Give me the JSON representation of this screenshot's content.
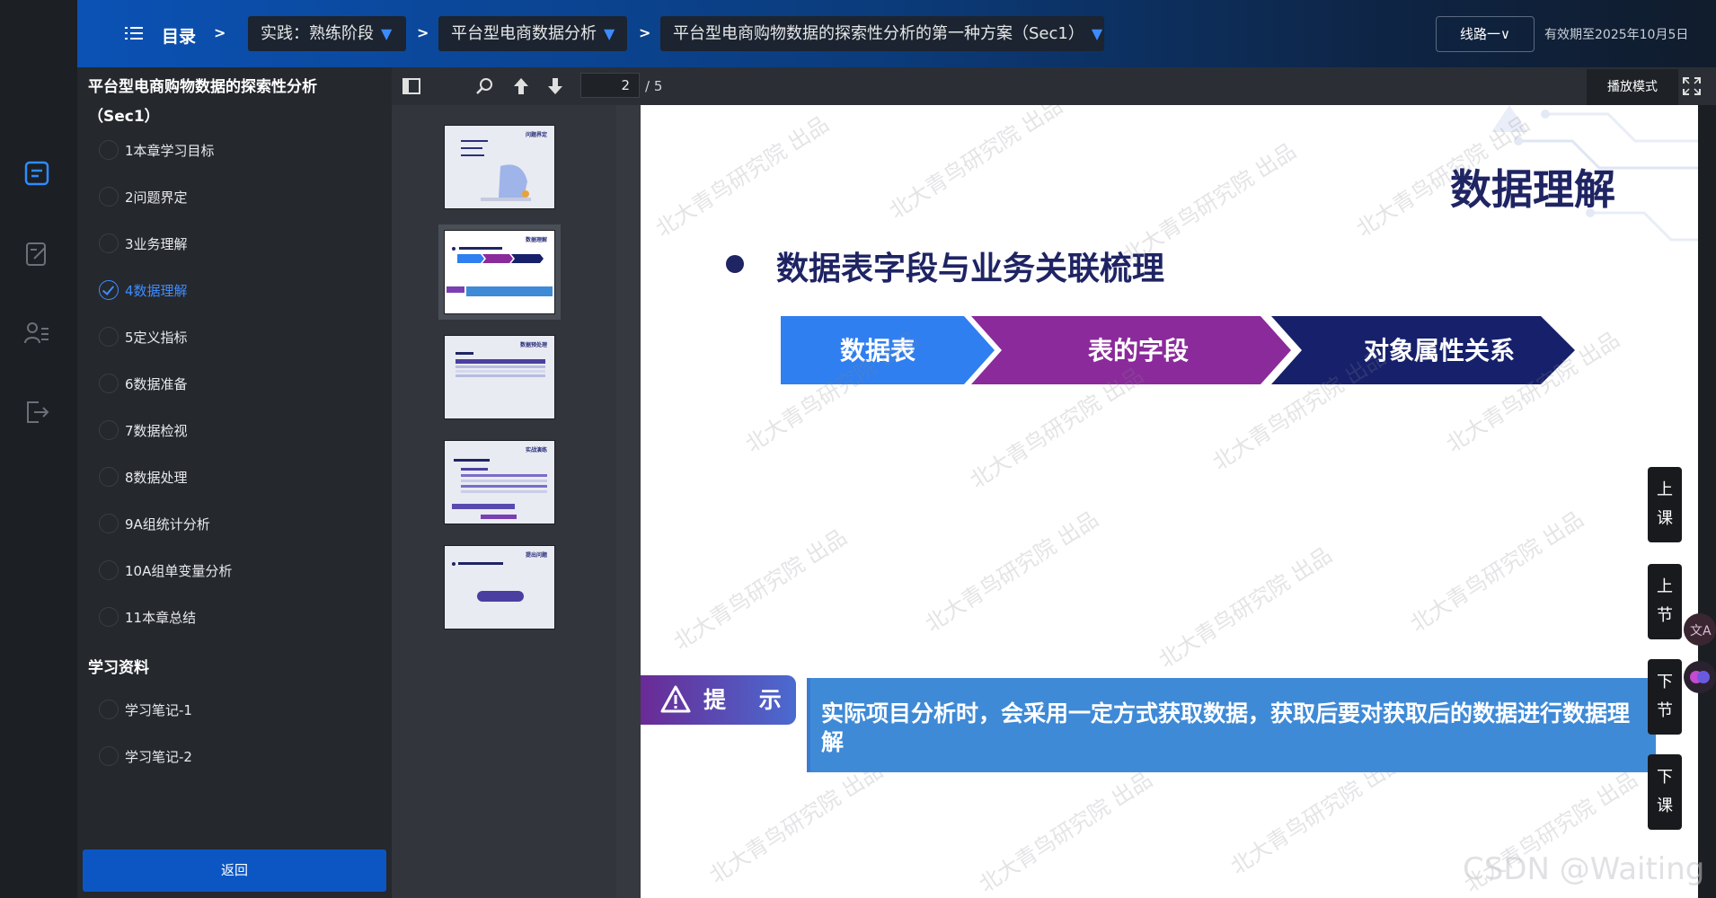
{
  "header": {
    "menu_label": "目录",
    "sep": ">",
    "crumbs": [
      {
        "label": "实践：熟练阶段"
      },
      {
        "label": "平台型电商数据分析"
      },
      {
        "label": "平台型电商购物数据的探索性分析的第一种方案（Sec1）"
      }
    ],
    "route_button": "线路一∨",
    "expiry": "有效期至2025年10月5日"
  },
  "chapters": {
    "title": "平台型电商购物数据的探索性分析（Sec1）",
    "items": [
      {
        "label": "1本章学习目标"
      },
      {
        "label": "2问题界定"
      },
      {
        "label": "3业务理解"
      },
      {
        "label": "4数据理解",
        "active": true
      },
      {
        "label": "5定义指标"
      },
      {
        "label": "6数据准备"
      },
      {
        "label": "7数据检视"
      },
      {
        "label": "8数据处理"
      },
      {
        "label": "9A组统计分析"
      },
      {
        "label": "10A组单变量分析"
      },
      {
        "label": "11本章总结"
      }
    ],
    "resources_title": "学习资料",
    "resources": [
      {
        "label": "学习笔记-1"
      },
      {
        "label": "学习笔记-2"
      }
    ],
    "back_button": "返回"
  },
  "pdf_toolbar": {
    "page_current": "2",
    "page_total": "/ 5",
    "play_mode": "播放模式"
  },
  "thumbnails": [
    {
      "heading": "问题界定"
    },
    {
      "heading": "数据理解",
      "selected": true
    },
    {
      "heading": "数据预处理"
    },
    {
      "heading": "实战演练"
    },
    {
      "heading": "提出问题"
    }
  ],
  "slide": {
    "title": "数据理解",
    "bullet": "数据表字段与业务关联梳理",
    "steps": [
      "数据表",
      "表的字段",
      "对象属性关系"
    ],
    "step_colors": [
      "#2f7ff0",
      "#8b2a9b",
      "#16206b"
    ],
    "tip_label": "提 示",
    "tip_text": "实际项目分析时，会采用一定方式获取数据，获取后要对获取后的数据进行数据理解",
    "watermark": "北大青鸟研究院 出品"
  },
  "side_nav": [
    {
      "chars": [
        "上",
        "课"
      ]
    },
    {
      "chars": [
        "上",
        "节"
      ]
    },
    {
      "chars": [
        "下",
        "节"
      ]
    },
    {
      "chars": [
        "下",
        "课"
      ]
    }
  ],
  "footer_watermark": "CSDN @Waiting"
}
